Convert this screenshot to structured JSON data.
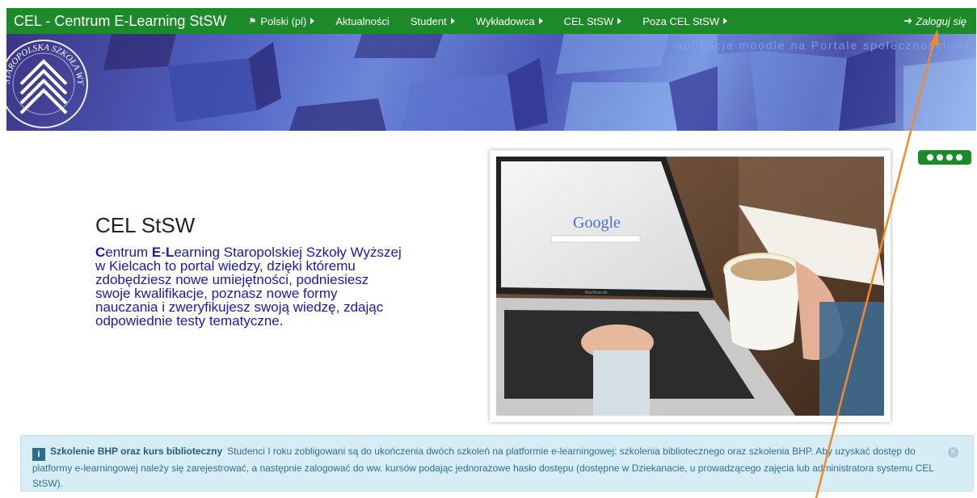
{
  "navbar": {
    "brand": "CEL - Centrum E-Learning StSW",
    "items": [
      {
        "label": "Polski (pl)",
        "has_flag": true,
        "has_caret": true
      },
      {
        "label": "Aktualności",
        "has_caret": false
      },
      {
        "label": "Student",
        "has_caret": true
      },
      {
        "label": "Wykładowca",
        "has_caret": true
      },
      {
        "label": "CEL StSW",
        "has_caret": true
      },
      {
        "label": "Poza CEL StSW",
        "has_caret": true
      }
    ],
    "login": "Zaloguj się"
  },
  "banner": {
    "text": "aplikacja moodle na  Portale społecznościowe",
    "seal_text": "STAROPOLSKA SZKOŁA WYŻSZA · MMI ·"
  },
  "hero": {
    "title": "CEL StSW",
    "desc_c": "C",
    "desc_1": "entrum ",
    "desc_e": "E",
    "desc_2": "-",
    "desc_l": "L",
    "desc_3": "earning Staropolskiej Szkoły Wyższej w Kielcach to portal wiedzy, dzięki któremu zdobędziesz nowe umiejętności, podniesiesz swoje kwalifikacje, poznasz nowe formy nauczania i zweryfikujesz swoją wiedzę, zdając odpowiednie testy tematyczne."
  },
  "photo": {
    "logo_text": "Google",
    "macbook_label": "MacBook Air"
  },
  "alert": {
    "icon": "i",
    "title": "Szkolenie BHP oraz kurs biblioteczny",
    "body": "Studenci I roku zobligowani są do ukończenia dwóch szkoleń na platformie e-learningowej: szkolenia bibliotecznego oraz szkolenia BHP. Aby uzyskać dostęp do platformy e-learningowej należy się zarejestrować, a następnie zalogować do ww. kursów podając jednorazowe hasło dostępu (dostępne w Dziekanacie, u prowadzącego zajęcia lub administratora systemu CEL StSW)."
  },
  "colors": {
    "nav_green": "#1d8a2a",
    "hero_blue": "#1a1aa6",
    "alert_bg": "#d7edf5",
    "annotation_orange": "#f08a2c"
  },
  "slider": {
    "dot_count": 4
  }
}
